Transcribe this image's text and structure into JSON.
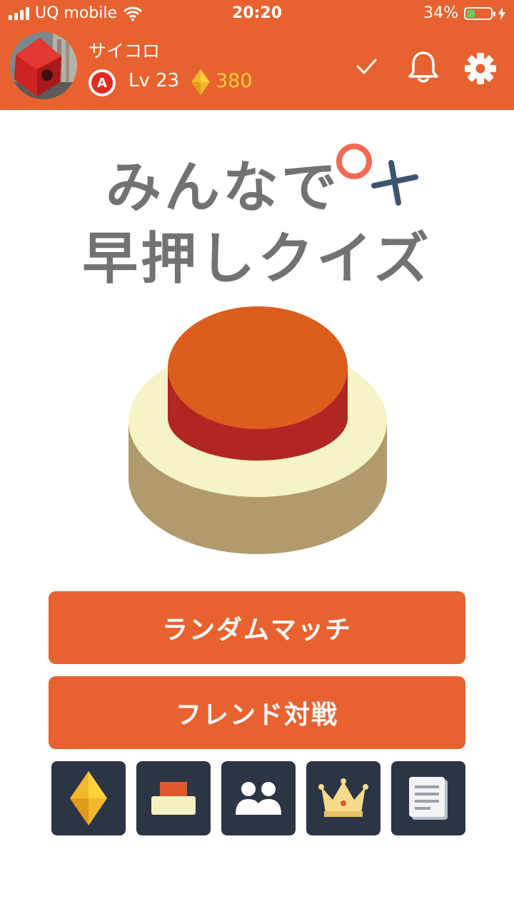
{
  "status_bar": {
    "carrier": "UQ mobile",
    "time": "20:20",
    "battery_percent": "34%",
    "battery_level": 0.34
  },
  "profile": {
    "username": "サイコロ",
    "rank": "A",
    "level": "Lv 23",
    "gems": "380"
  },
  "title": {
    "line1": "みんなで",
    "line2": "早押しクイズ"
  },
  "buttons": {
    "random_match": "ランダムマッチ",
    "friend_battle": "フレンド対戦"
  },
  "menu_tiles": [
    {
      "icon": "gem-icon"
    },
    {
      "icon": "buzzer-icon"
    },
    {
      "icon": "friends-icon"
    },
    {
      "icon": "crown-icon"
    },
    {
      "icon": "document-icon"
    }
  ],
  "colors": {
    "brand_orange": "#e8622f",
    "tile_navy": "#2c3545",
    "gem_yellow": "#ffd23a",
    "title_gray": "#727272"
  }
}
